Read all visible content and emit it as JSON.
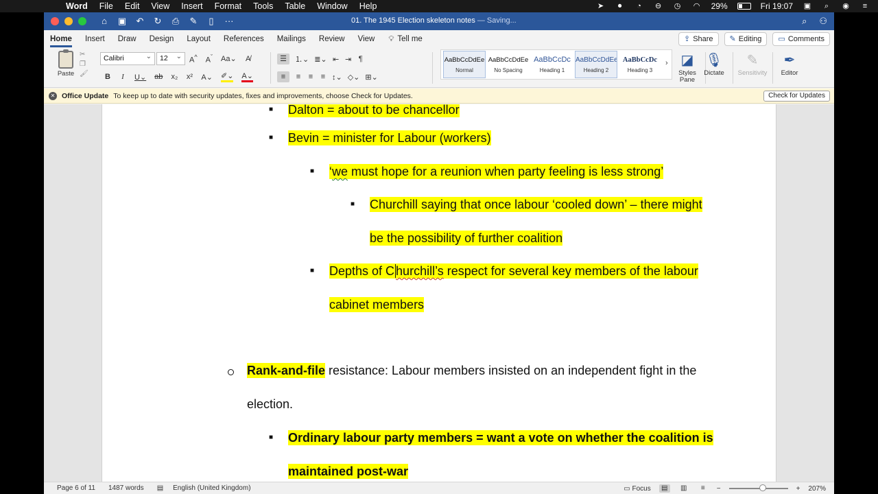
{
  "menubar": {
    "app_name": "Word",
    "items": [
      "File",
      "Edit",
      "View",
      "Insert",
      "Format",
      "Tools",
      "Table",
      "Window",
      "Help"
    ],
    "battery": "29%",
    "clock": "Fri 19:07"
  },
  "window": {
    "doc_title": "01. The 1945 Election skeleton notes",
    "save_status": "— Saving...",
    "tabs": [
      "Home",
      "Insert",
      "Draw",
      "Design",
      "Layout",
      "References",
      "Mailings",
      "Review",
      "View"
    ],
    "active_tab": "Home",
    "tell_me": "Tell me",
    "share": "Share",
    "editing": "Editing",
    "comments": "Comments"
  },
  "ribbon": {
    "paste_label": "Paste",
    "font_name": "Calibri",
    "font_size": "12",
    "styles": [
      {
        "preview": "AaBbCcDdEe",
        "name": "Normal"
      },
      {
        "preview": "AaBbCcDdEe",
        "name": "No Spacing"
      },
      {
        "preview": "AaBbCcDc",
        "name": "Heading 1"
      },
      {
        "preview": "AaBbCcDdEe",
        "name": "Heading 2"
      },
      {
        "preview": "AaBbCcDc",
        "name": "Heading 3"
      }
    ],
    "styles_pane": "Styles Pane",
    "dictate": "Dictate",
    "sensitivity": "Sensitivity",
    "editor": "Editor"
  },
  "update_bar": {
    "title": "Office Update",
    "message": "To keep up to date with security updates, fixes and improvements, choose Check for Updates.",
    "button": "Check for Updates"
  },
  "document": {
    "l1": "Dalton = about to be chancellor",
    "l2": "Bevin = minister for Labour (workers)",
    "l3_a": "‘",
    "l3_b": "we",
    "l3_c": " must hope for a reunion when party feeling is less strong’",
    "l4": "Churchill saying that once labour ‘cooled down’ – there might",
    "l5": "be the possibility of further coalition",
    "l6_a": "Depths of C",
    "l6_b": "hurchill’s",
    "l6_c": " respect for several key members of the labour",
    "l7": "cabinet members",
    "l8_bold": "Rank-and-file",
    "l8_rest": " resistance: Labour members insisted on an independent fight in the",
    "l9": "election.",
    "l10": "Ordinary labour party members = want a vote on whether the coalition is",
    "l11": "maintained post-war"
  },
  "status": {
    "page": "Page 6 of 11",
    "words": "1487 words",
    "language": "English (United Kingdom)",
    "focus": "Focus",
    "zoom": "207%"
  }
}
